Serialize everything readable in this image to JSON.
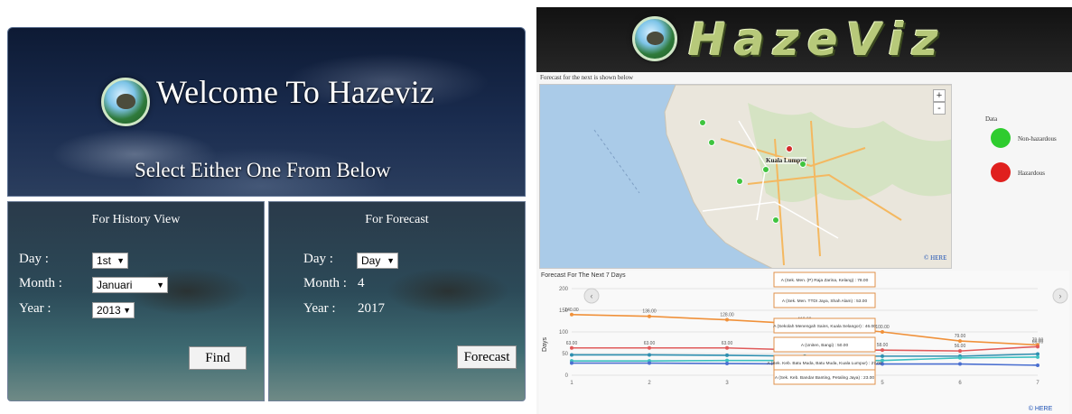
{
  "welcome_page": {
    "title": "Welcome To Hazeviz",
    "subtitle": "Select Either One From Below",
    "history": {
      "heading": "For History View",
      "day_label": "Day :",
      "day_value": "1st",
      "month_label": "Month :",
      "month_value": "Januari",
      "year_label": "Year :",
      "year_value": "2013",
      "find_button": "Find"
    },
    "forecast": {
      "heading": "For Forecast",
      "day_label": "Day :",
      "day_value": "Day",
      "month_label": "Month :",
      "month_value": "4",
      "year_label": "Year :",
      "year_value": "2017",
      "forecast_button": "Forecast"
    }
  },
  "hazeviz_page": {
    "app_title": "HazeViz",
    "map_caption": "Forecast for the next is shown below",
    "zoom_in": "+",
    "zoom_out": "-",
    "map_label": "Kuala Lumpur",
    "map_credit": "© HERE",
    "legend": {
      "title": "Data",
      "items": [
        {
          "label": "Non-hazardous",
          "color": "#2ecc2e"
        },
        {
          "label": "Hazardous",
          "color": "#e0201e"
        }
      ]
    },
    "markers": {
      "safe_color": "#3fc43f",
      "hazard_color": "#d42a2a"
    },
    "chart_credit": "© HERE"
  },
  "chart_data": {
    "type": "line",
    "title": "Forecast For The Next 7 Days",
    "xlabel": "",
    "ylabel": "Days",
    "x": [
      1,
      2,
      3,
      4,
      5,
      6,
      7
    ],
    "ylim": [
      0,
      200
    ],
    "y_ticks": [
      0,
      50,
      100,
      150,
      200
    ],
    "series": [
      {
        "color": "#f0913a",
        "values": [
          140,
          136,
          128,
          118,
          100,
          79,
          70
        ]
      },
      {
        "color": "#e05a5a",
        "values": [
          63,
          63,
          63,
          58,
          58,
          56,
          66
        ]
      },
      {
        "color": "#2e8fb0",
        "values": [
          47,
          47,
          46,
          44,
          44,
          44,
          49
        ]
      },
      {
        "color": "#3cc0c0",
        "values": [
          33,
          33,
          34,
          34,
          34,
          40,
          42
        ]
      },
      {
        "color": "#4a6fd0",
        "values": [
          28,
          28,
          27,
          26,
          26,
          26,
          23
        ]
      }
    ],
    "tooltips": [
      "A (Sek. Men. (P) Raja Zarina, Kelang) : 78.00",
      "A (Sek. Men. TTDI Jaya, Shah Alam) : 53.00",
      "A (Sekolah Menengah Sains, Kuala Selangor) : 46.00",
      "A (Uniten, Bangi) : 50.00",
      "A (Sek. Keb. Batu Muda, Batu Muda, Kuala Lumpur) : 27.00",
      "A (Sek. Keb. Bandar Banting, Petaling Jaya) : 23.00"
    ]
  }
}
